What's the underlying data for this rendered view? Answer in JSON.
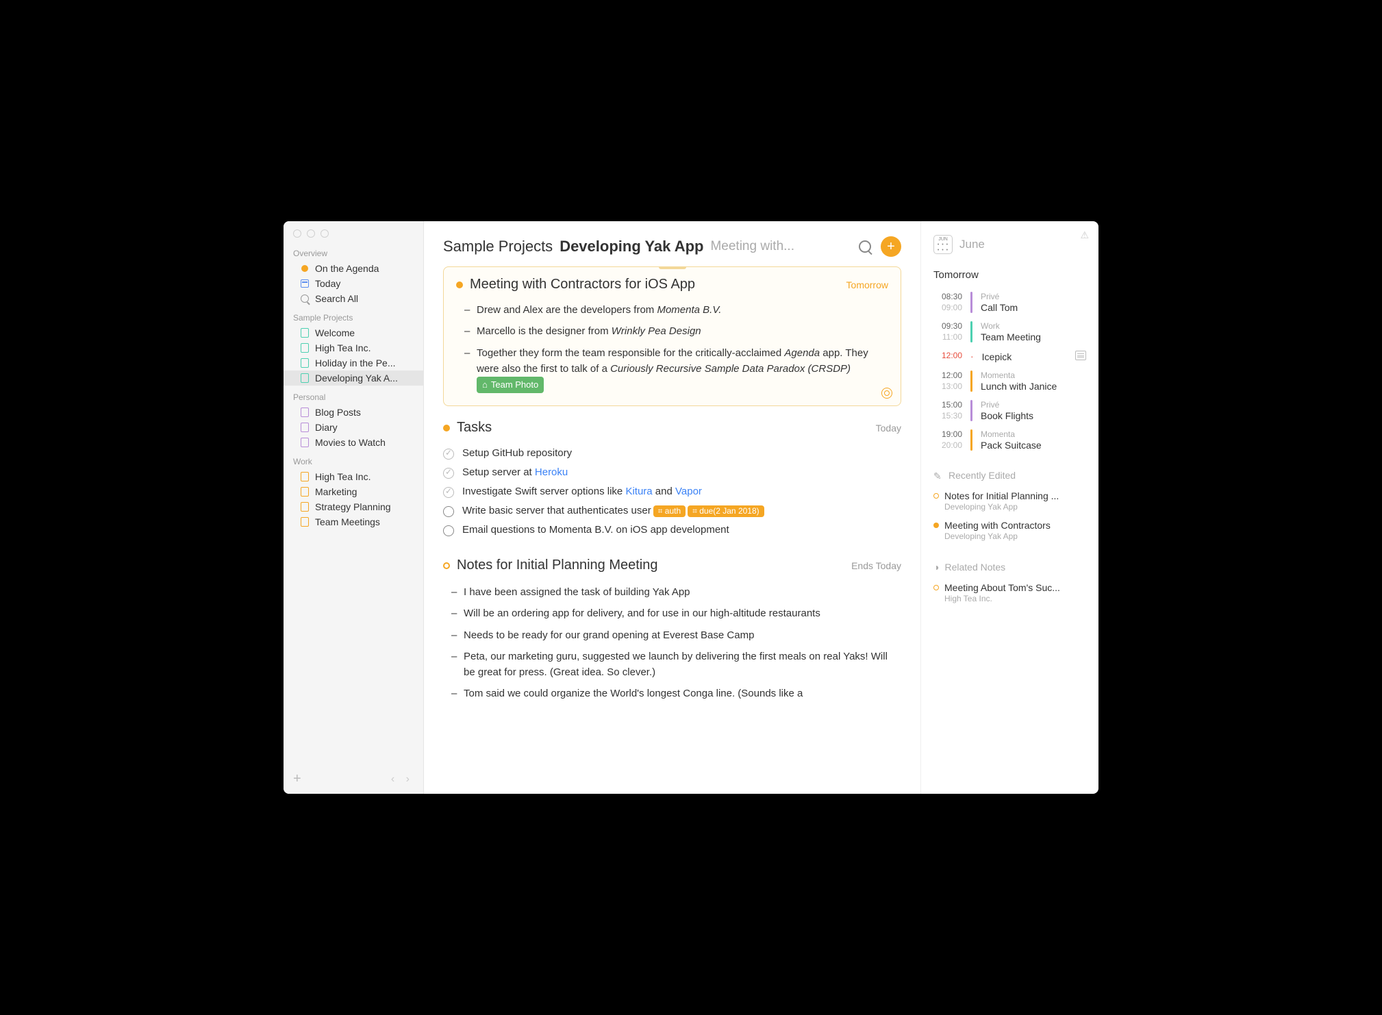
{
  "sidebar": {
    "overview_header": "Overview",
    "overview": [
      {
        "icon": "dot-filled",
        "label": "On the Agenda"
      },
      {
        "icon": "cal",
        "label": "Today"
      },
      {
        "icon": "search",
        "label": "Search All"
      }
    ],
    "sample_header": "Sample Projects",
    "sample": [
      {
        "label": "Welcome"
      },
      {
        "label": "High Tea Inc."
      },
      {
        "label": "Holiday in the Pe..."
      },
      {
        "label": "Developing Yak A..."
      }
    ],
    "personal_header": "Personal",
    "personal": [
      {
        "label": "Blog Posts"
      },
      {
        "label": "Diary"
      },
      {
        "label": "Movies to Watch"
      }
    ],
    "work_header": "Work",
    "work": [
      {
        "label": "High Tea Inc."
      },
      {
        "label": "Marketing"
      },
      {
        "label": "Strategy Planning"
      },
      {
        "label": "Team Meetings"
      }
    ]
  },
  "breadcrumb": {
    "parent": "Sample Projects",
    "current": "Developing Yak App",
    "trail": "Meeting with..."
  },
  "note1": {
    "title": "Meeting with Contractors for iOS App",
    "meta": "Tomorrow",
    "b1a": "Drew and Alex are the developers from ",
    "b1b": "Momenta B.V.",
    "b2a": "Marcello is the designer from ",
    "b2b": "Wrinkly Pea Design",
    "b3a": "Together they form the team responsible for the critically-acclaimed ",
    "b3b": "Agenda",
    "b3c": " app. They were also the first to talk of a ",
    "b3d": "Curiously Recursive Sample Data Paradox (CRSDP)",
    "attach": "Team Photo"
  },
  "tasks": {
    "title": "Tasks",
    "meta": "Today",
    "t1": "Setup GitHub repository",
    "t2a": "Setup server at ",
    "t2b": "Heroku",
    "t3a": "Investigate Swift server options like ",
    "t3b": "Kitura",
    "t3c": " and ",
    "t3d": "Vapor",
    "t4": "Write basic server that authenticates user",
    "t4tag1": "⌗ auth",
    "t4tag2": "⌗ due(2 Jan 2018)",
    "t5": "Email questions to Momenta B.V. on iOS app development"
  },
  "note3": {
    "title": "Notes for Initial Planning Meeting",
    "meta": "Ends Today",
    "b1": "I have been assigned the task of building Yak App",
    "b2": "Will be an ordering app for delivery, and for use in our high-altitude restaurants",
    "b3": "Needs to be ready for our grand opening at Everest Base Camp",
    "b4": "Peta, our marketing guru, suggested we launch by delivering the first meals on real Yaks! Will be great for press. (Great idea. So clever.)",
    "b5": "Tom said we could organize the World's longest Conga line. (Sounds like a"
  },
  "calendar": {
    "badge_month": "JUN",
    "month": "June",
    "section": "Tomorrow",
    "events": [
      {
        "start": "08:30",
        "end": "09:00",
        "bar": "purple",
        "cal": "Privé",
        "title": "Call Tom",
        "red": false,
        "note": false
      },
      {
        "start": "09:30",
        "end": "11:00",
        "bar": "teal",
        "cal": "Work",
        "title": "Team Meeting",
        "red": false,
        "note": false
      },
      {
        "start": "12:00",
        "end": "",
        "bar": "",
        "cal": "",
        "title": "Icepick",
        "red": true,
        "note": true
      },
      {
        "start": "12:00",
        "end": "13:00",
        "bar": "orange",
        "cal": "Momenta",
        "title": "Lunch with Janice",
        "red": false,
        "note": false
      },
      {
        "start": "15:00",
        "end": "15:30",
        "bar": "purple",
        "cal": "Privé",
        "title": "Book Flights",
        "red": false,
        "note": false
      },
      {
        "start": "19:00",
        "end": "20:00",
        "bar": "orange",
        "cal": "Momenta",
        "title": "Pack Suitcase",
        "red": false,
        "note": false
      }
    ]
  },
  "recent": {
    "header": "Recently Edited",
    "items": [
      {
        "title": "Notes for Initial Planning ...",
        "sub": "Developing Yak App",
        "fill": false
      },
      {
        "title": "Meeting with Contractors",
        "sub": "Developing Yak App",
        "fill": true
      }
    ]
  },
  "related": {
    "header": "Related Notes",
    "items": [
      {
        "title": "Meeting About Tom's Suc...",
        "sub": "High Tea Inc.",
        "fill": false
      }
    ]
  }
}
